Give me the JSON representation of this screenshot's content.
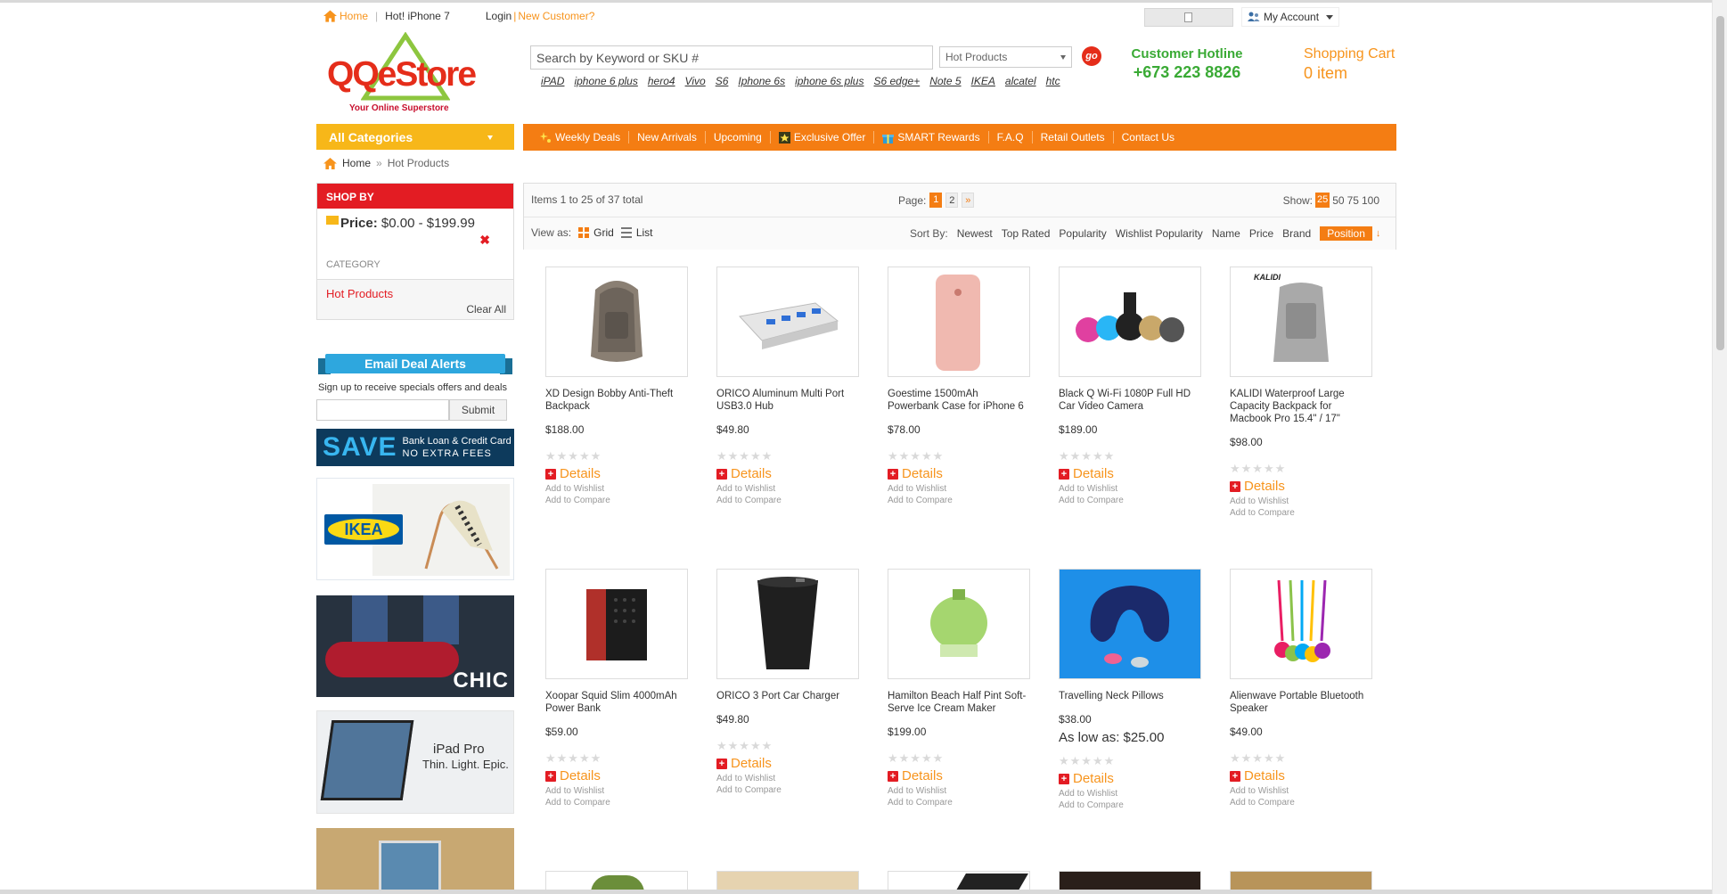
{
  "top": {
    "home": "Home",
    "hot": "Hot! iPhone 7",
    "login": "Login",
    "divider": "|",
    "new_customer": "New Customer?",
    "my_account": "My Account"
  },
  "logo": {
    "name": "QQeStore",
    "tagline": "Your Online Superstore"
  },
  "search": {
    "placeholder": "Search by Keyword or SKU #",
    "category": "Hot Products",
    "go": "go",
    "quick_links": [
      "iPAD",
      "iphone 6 plus",
      "hero4",
      "Vivo",
      "S6",
      "Iphone 6s",
      "iphone 6s plus",
      "S6 edge+",
      "Note 5",
      "IKEA",
      "alcatel",
      "htc"
    ]
  },
  "hotline": {
    "label": "Customer Hotline",
    "number": "+673 223 8826"
  },
  "cart": {
    "label": "Shopping Cart",
    "count": "0 item"
  },
  "all_categories": "All Categories",
  "nav": [
    "Weekly Deals",
    "New Arrivals",
    "Upcoming",
    "Exclusive Offer",
    "SMART Rewards",
    "F.A.Q",
    "Retail Outlets",
    "Contact Us"
  ],
  "breadcrumb": {
    "home": "Home",
    "sep": "»",
    "current": "Hot Products"
  },
  "sidebar": {
    "shop_by": "SHOP BY",
    "price_label": "Price:",
    "price_value": "$0.00 - $199.99",
    "remove": "✖",
    "category_label": "CATEGORY",
    "category_value": "Hot Products",
    "clear_all": "Clear All",
    "email_alerts": "Email Deal Alerts",
    "signup_text": "Sign up to receive specials offers and deals",
    "submit": "Submit"
  },
  "ads": {
    "save_big": "SAVE",
    "save_line1": "Bank Loan & Credit Card",
    "save_line2": "NO EXTRA FEES",
    "ikea": "IKEA",
    "chic": "CHIC",
    "ipad_title": "iPad Pro",
    "ipad_tag": "Thin. Light. Epic."
  },
  "toolbar": {
    "count": "Items 1 to 25 of 37 total",
    "page_label": "Page:",
    "pages": [
      "1",
      "2"
    ],
    "next": "»",
    "show_label": "Show:",
    "show_options": [
      "25",
      "50",
      "75",
      "100"
    ],
    "view_as": "View as:",
    "grid": "Grid",
    "list": "List",
    "sort_by": "Sort By:",
    "sort_options": [
      "Newest",
      "Top Rated",
      "Popularity",
      "Wishlist Popularity",
      "Name",
      "Price",
      "Brand",
      "Position"
    ],
    "sort_dir": "↓"
  },
  "product_common": {
    "stars": "★★★★★",
    "details": "Details",
    "plus": "+",
    "wishlist": "Add to Wishlist",
    "compare": "Add to Compare",
    "low_as_label": "As low as:"
  },
  "products": [
    {
      "name": "XD Design Bobby Anti-Theft Backpack",
      "price": "$188.00"
    },
    {
      "name": "ORICO Aluminum Multi Port USB3.0 Hub",
      "price": "$49.80"
    },
    {
      "name": "Goestime 1500mAh Powerbank Case for iPhone 6",
      "price": "$78.00"
    },
    {
      "name": "Black Q Wi-Fi 1080P Full HD Car Video Camera",
      "price": "$189.00"
    },
    {
      "name": "KALIDI Waterproof Large Capacity Backpack for Macbook Pro 15.4\" / 17\"",
      "price": "$98.00",
      "brand_mark": "KALIDI"
    },
    {
      "name": "Xoopar Squid Slim 4000mAh Power Bank",
      "price": "$59.00"
    },
    {
      "name": "ORICO 3 Port Car Charger",
      "price": "$49.80"
    },
    {
      "name": "Hamilton Beach Half Pint Soft-Serve Ice Cream Maker",
      "price": "$199.00"
    },
    {
      "name": "Travelling Neck Pillows",
      "price": "$38.00",
      "low_as": "$25.00"
    },
    {
      "name": "Alienwave Portable Bluetooth Speaker",
      "price": "$49.00"
    }
  ],
  "colors": {
    "orange": "#f47d13",
    "yellow": "#f7b719",
    "red": "#e31c23",
    "green": "#3aaa35",
    "link_orange": "#f7941d"
  }
}
